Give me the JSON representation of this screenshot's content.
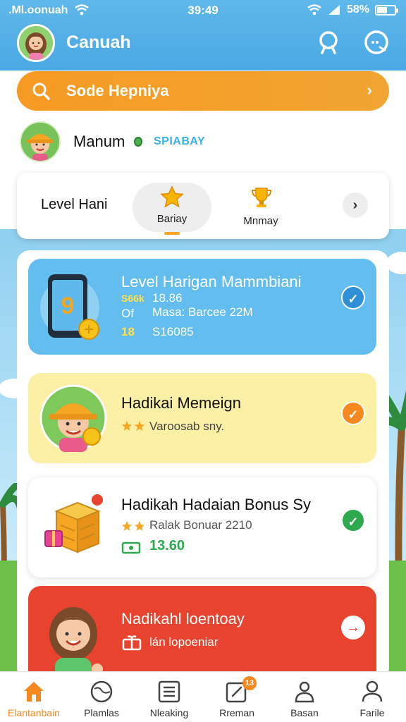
{
  "status_bar": {
    "carrier": ".Ml.oonuah",
    "time": "39:49",
    "battery": "58%"
  },
  "header": {
    "title": "Canuah"
  },
  "search": {
    "placeholder": "Sode Hepniya"
  },
  "user": {
    "name": "Manum",
    "badge": "SPIABAY"
  },
  "level_tabs": {
    "label": "Level Hani",
    "tabs": [
      {
        "label": "Bariay",
        "icon": "star-icon",
        "active": true
      },
      {
        "label": "Mnmay",
        "icon": "trophy-icon",
        "active": false
      }
    ]
  },
  "cards": [
    {
      "title": "Level Harigan Mammbiani",
      "line1_tag": "S66k",
      "line1_text": "18.86",
      "line2_tag": "Of",
      "line2_text": "Masa: Barcee 22M",
      "line3_tag": "18",
      "line3_text": "S16085",
      "status": "check"
    },
    {
      "title": "Hadikai Memeign",
      "line1_text": "Varoosab sny."
    },
    {
      "title": "Hadikah Hadaian Bonus Sy",
      "line1_text": "Ralak Bonuar 2210",
      "line2_text": "13.60"
    },
    {
      "title": "Nadikahl loentoay",
      "line1_text": "lán lopoeniar"
    }
  ],
  "bottom_nav": [
    {
      "label": "Elantanbain",
      "icon": "home-icon",
      "active": true
    },
    {
      "label": "Plamlas",
      "icon": "globe-icon",
      "active": false
    },
    {
      "label": "Nleaking",
      "icon": "list-icon",
      "active": false
    },
    {
      "label": "Rreman",
      "icon": "edit-icon",
      "active": false,
      "badge": "13"
    },
    {
      "label": "Basan",
      "icon": "user-bag-icon",
      "active": false
    },
    {
      "label": "Farile",
      "icon": "profile-icon",
      "active": false
    }
  ],
  "colors": {
    "accent": "#f59a23",
    "header": "#4aa8e3",
    "card_blue": "#63bdee",
    "card_yellow": "#fbf0a6",
    "card_red": "#e8432e",
    "success": "#2ea94f"
  }
}
